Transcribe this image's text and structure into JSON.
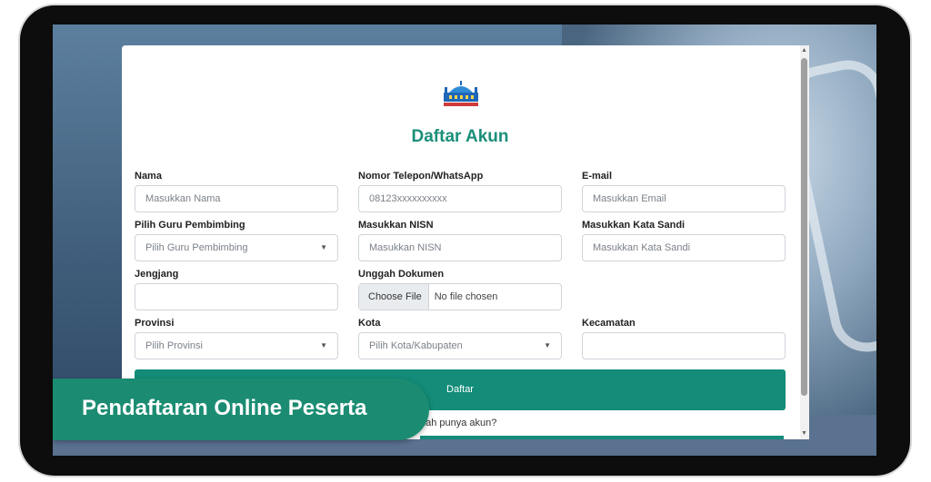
{
  "form": {
    "title": "Daftar Akun",
    "fields": {
      "nama": {
        "label": "Nama",
        "placeholder": "Masukkan Nama"
      },
      "telepon": {
        "label": "Nomor Telepon/WhatsApp",
        "placeholder": "08123xxxxxxxxxx"
      },
      "email": {
        "label": "E-mail",
        "placeholder": "Masukkan Email"
      },
      "guru": {
        "label": "Pilih Guru Pembimbing",
        "placeholder": "Pilih Guru Pembimbing"
      },
      "nisn": {
        "label": "Masukkan NISN",
        "placeholder": "Masukkan NISN"
      },
      "sandi": {
        "label": "Masukkan Kata Sandi",
        "placeholder": "Masukkan Kata Sandi"
      },
      "jenjang": {
        "label": "Jengjang",
        "placeholder": ""
      },
      "dokumen": {
        "label": "Unggah Dokumen",
        "button": "Choose File",
        "status": "No file chosen"
      },
      "provinsi": {
        "label": "Provinsi",
        "placeholder": "Pilih Provinsi"
      },
      "kota": {
        "label": "Kota",
        "placeholder": "Pilih Kota/Kabupaten"
      },
      "kecamatan": {
        "label": "Kecamatan",
        "placeholder": ""
      }
    },
    "submit_label": "Daftar",
    "login_prompt": "dah punya akun?"
  },
  "banner": {
    "text": "Pendaftaran Online Peserta"
  },
  "icons": {
    "logo": "mosque-logo",
    "dropdown": "chevron-down-icon"
  },
  "colors": {
    "accent": "#138c79",
    "title": "#1a8f7a",
    "banner": "#1b8c72"
  }
}
